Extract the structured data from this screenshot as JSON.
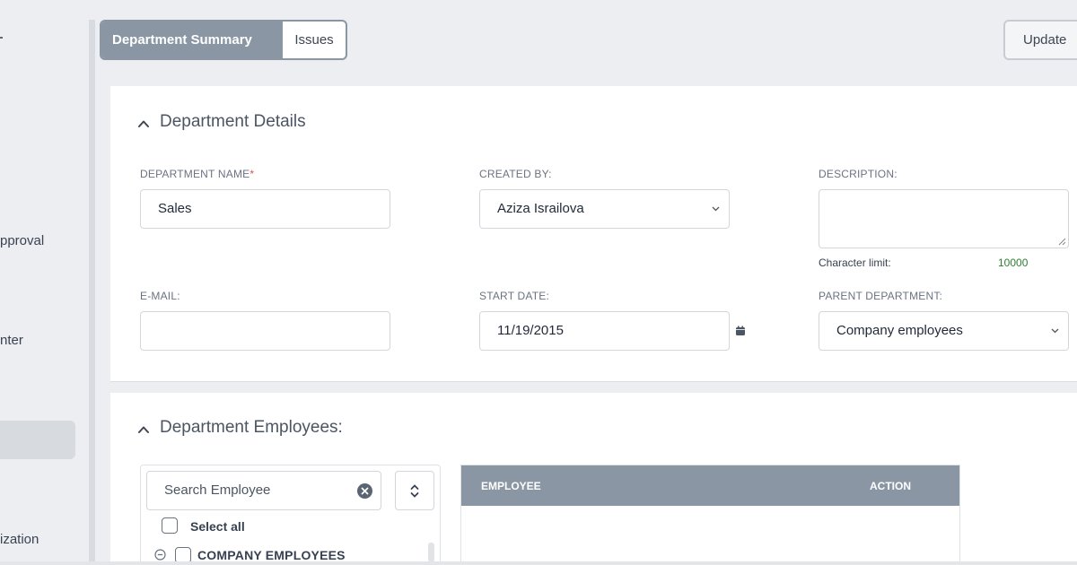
{
  "sidebar": {
    "items": [
      {
        "label": "pproval"
      },
      {
        "label": "nter"
      },
      {
        "label": "ization"
      }
    ]
  },
  "tabs": [
    {
      "label": "Department Summary",
      "active": true
    },
    {
      "label": "Issues",
      "active": false
    }
  ],
  "toolbar": {
    "update_label": "Update"
  },
  "details": {
    "title": "Department Details",
    "department_name": {
      "label": "DEPARTMENT NAME",
      "required_mark": "*",
      "value": "Sales"
    },
    "created_by": {
      "label": "CREATED BY:",
      "value": "Aziza Israilova"
    },
    "description": {
      "label": "DESCRIPTION:",
      "value": "",
      "char_limit_label": "Character limit:",
      "char_limit_value": "10000"
    },
    "email": {
      "label": "E-MAIL:",
      "value": ""
    },
    "start_date": {
      "label": "START DATE:",
      "value": "11/19/2015"
    },
    "parent_department": {
      "label": "PARENT DEPARTMENT:",
      "value": "Company employees"
    }
  },
  "employees": {
    "title": "Department Employees:",
    "search_placeholder": "Search Employee",
    "select_all_label": "Select all",
    "tree_root_label": "COMPANY EMPLOYEES",
    "table_headers": [
      "EMPLOYEE",
      "ACTION"
    ]
  },
  "colors": {
    "accent_gray": "#8a96a3",
    "char_limit_green": "#2e7d32",
    "required_red": "#d9534f"
  },
  "icons": [
    "chevron-up-icon",
    "chevron-down-icon",
    "calendar-icon",
    "clear-icon",
    "sort-icon",
    "collapse-icon",
    "resize-grip-icon"
  ]
}
